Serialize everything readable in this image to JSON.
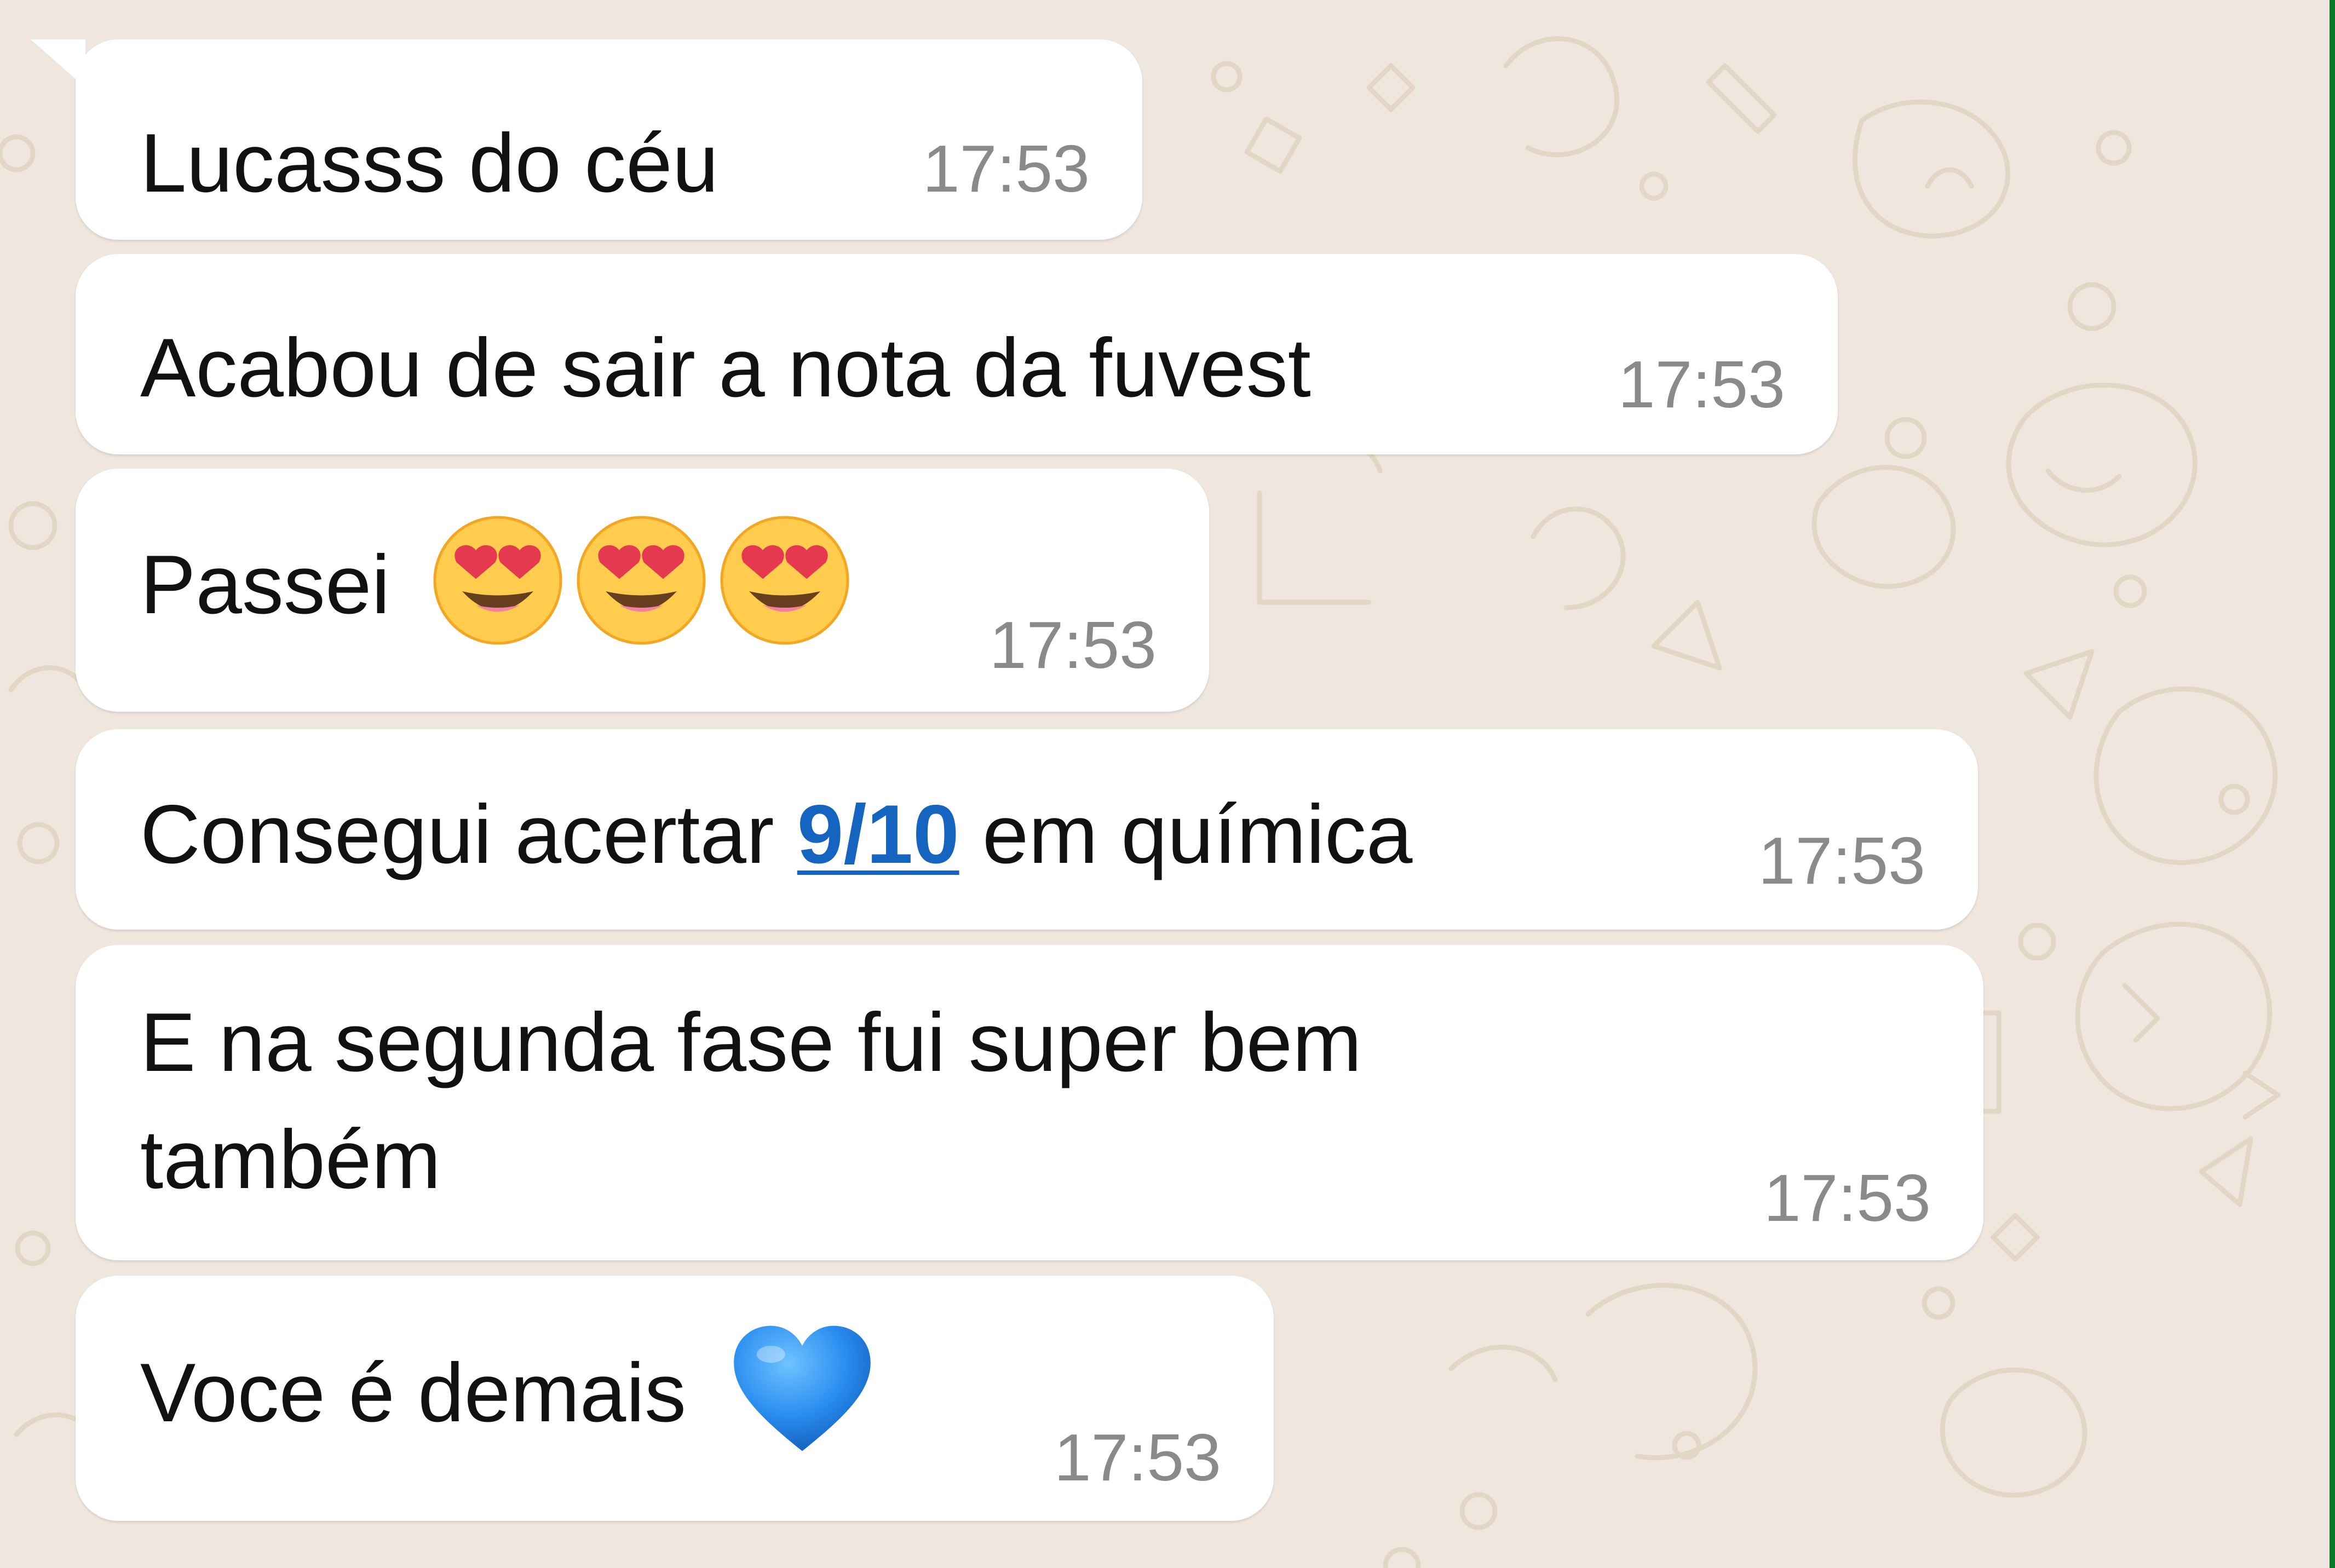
{
  "theme": {
    "wallpaper_color": "#efe7dd",
    "doodle_color": "#e4d6c4",
    "bubble_color": "#ffffff",
    "text_color": "#111111",
    "time_color": "#8a8a8a",
    "link_color": "#1565c0",
    "edge_color": "#0a7a2a"
  },
  "messages": [
    {
      "text": "Lucasss do céu",
      "time": "17:53"
    },
    {
      "text": "Acabou de sair a nota da fuvest",
      "time": "17:53"
    },
    {
      "text": "Passei",
      "emojis": [
        "smiling-face-with-heart-eyes",
        "smiling-face-with-heart-eyes",
        "smiling-face-with-heart-eyes"
      ],
      "time": "17:53"
    },
    {
      "text_before": "Consegui acertar ",
      "link": "9/10",
      "text_after": " em química",
      "time": "17:53"
    },
    {
      "line1": "E na segunda fase fui super bem",
      "line2": "também",
      "time": "17:53"
    },
    {
      "text": "Voce é demais",
      "emojis": [
        "blue-heart"
      ],
      "time": "17:53"
    }
  ]
}
